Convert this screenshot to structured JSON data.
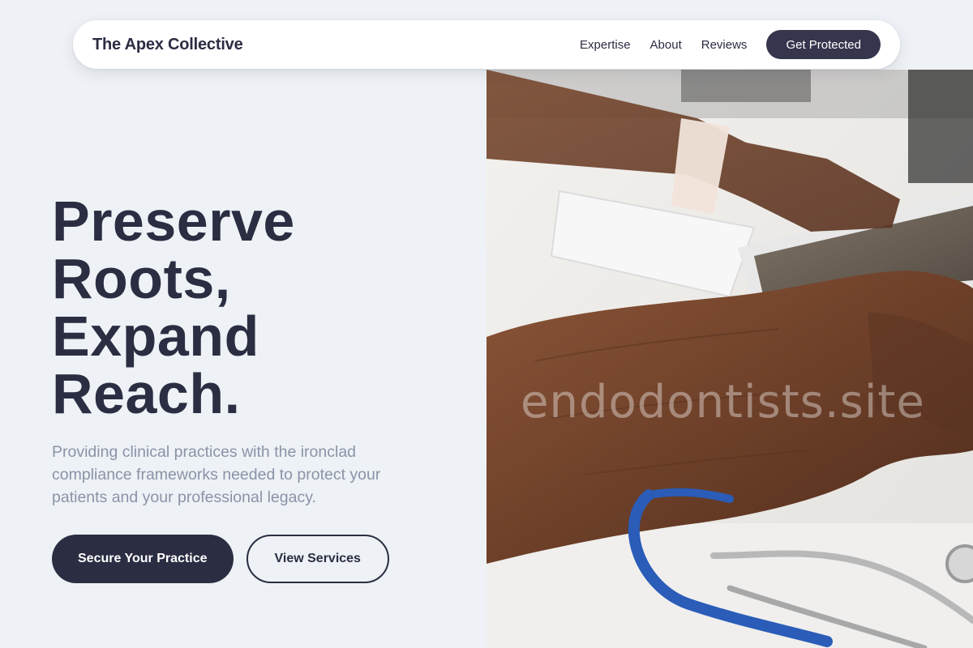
{
  "nav": {
    "brand": "The Apex Collective",
    "links": [
      "Expertise",
      "About",
      "Reviews"
    ],
    "cta": "Get Protected"
  },
  "hero": {
    "headline": [
      "Preserve",
      "Roots,",
      "Expand",
      "Reach."
    ],
    "subtext": "Providing clinical practices with the ironclad compliance frameworks needed to protect your patients and your professional legacy.",
    "primary_button": "Secure Your Practice",
    "secondary_button": "View Services",
    "image_watermark": "endodontists.site"
  },
  "colors": {
    "background": "#eef1f5",
    "primary": "#2b2d42",
    "nav_cta": "#35364d",
    "subtext": "#8a93a8"
  }
}
